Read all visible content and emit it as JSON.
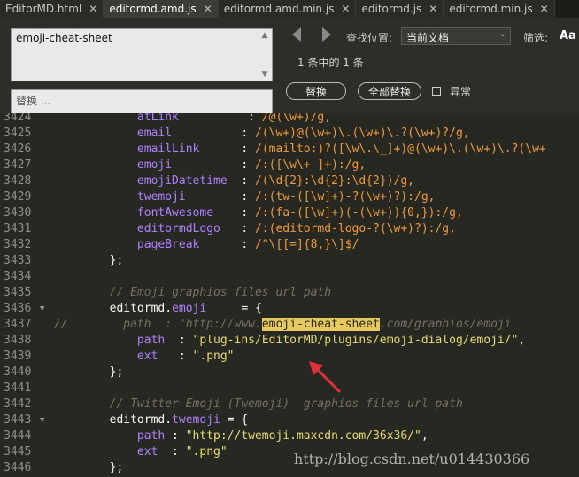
{
  "tabs": [
    {
      "label": "EditorMD.html",
      "active": false
    },
    {
      "label": "editormd.amd.js",
      "active": true
    },
    {
      "label": "editormd.amd.min.js",
      "active": false
    },
    {
      "label": "editormd.js",
      "active": false
    },
    {
      "label": "editormd.min.js",
      "active": false
    }
  ],
  "find": {
    "query": "emoji-cheat-sheet",
    "replace_placeholder": "替换 ...",
    "search_location_label": "查找位置:",
    "scope": "当前文档",
    "filter_label": "筛选:",
    "case_label": "Aa",
    "match_count": "1 条中的 1 条",
    "replace_button": "替换",
    "replace_all_button": "全部替换",
    "regex_label": "异常"
  },
  "editor": {
    "lines": [
      {
        "n": "3424",
        "fold": "",
        "parts": [
          {
            "t": "            ",
            "c": ""
          },
          {
            "t": "atLink",
            "c": "tok-prop"
          },
          {
            "t": "          : ",
            "c": ""
          },
          {
            "t": "/@(\\w+)/g,",
            "c": "tok-regex"
          }
        ]
      },
      {
        "n": "3425",
        "fold": "",
        "parts": [
          {
            "t": "            ",
            "c": ""
          },
          {
            "t": "email",
            "c": "tok-prop"
          },
          {
            "t": "          : ",
            "c": ""
          },
          {
            "t": "/(\\w+)@(\\w+)\\.(\\w+)\\.?(\\w+)?/g,",
            "c": "tok-regex"
          }
        ]
      },
      {
        "n": "3426",
        "fold": "",
        "parts": [
          {
            "t": "            ",
            "c": ""
          },
          {
            "t": "emailLink",
            "c": "tok-prop"
          },
          {
            "t": "      : ",
            "c": ""
          },
          {
            "t": "/(mailto:)?([\\w\\.\\_]+)@(\\w+)\\.(\\w+)\\.?(\\w+",
            "c": "tok-regex"
          }
        ]
      },
      {
        "n": "3427",
        "fold": "",
        "parts": [
          {
            "t": "            ",
            "c": ""
          },
          {
            "t": "emoji",
            "c": "tok-prop"
          },
          {
            "t": "          : ",
            "c": ""
          },
          {
            "t": "/:([\\w\\+-]+):/g,",
            "c": "tok-regex"
          }
        ]
      },
      {
        "n": "3428",
        "fold": "",
        "parts": [
          {
            "t": "            ",
            "c": ""
          },
          {
            "t": "emojiDatetime",
            "c": "tok-prop"
          },
          {
            "t": "  : ",
            "c": ""
          },
          {
            "t": "/(\\d{2}:\\d{2}:\\d{2})/g,",
            "c": "tok-regex"
          }
        ]
      },
      {
        "n": "3429",
        "fold": "",
        "parts": [
          {
            "t": "            ",
            "c": ""
          },
          {
            "t": "twemoji",
            "c": "tok-prop"
          },
          {
            "t": "        : ",
            "c": ""
          },
          {
            "t": "/:(tw-([\\w]+)-?(\\w+)?):/g,",
            "c": "tok-regex"
          }
        ]
      },
      {
        "n": "3430",
        "fold": "",
        "parts": [
          {
            "t": "            ",
            "c": ""
          },
          {
            "t": "fontAwesome",
            "c": "tok-prop"
          },
          {
            "t": "    : ",
            "c": ""
          },
          {
            "t": "/:(fa-([\\w]+)(-(\\w+)){0,}):/g,",
            "c": "tok-regex"
          }
        ]
      },
      {
        "n": "3431",
        "fold": "",
        "parts": [
          {
            "t": "            ",
            "c": ""
          },
          {
            "t": "editormdLogo",
            "c": "tok-prop"
          },
          {
            "t": "   : ",
            "c": ""
          },
          {
            "t": "/:(editormd-logo-?(\\w+)?):/g,",
            "c": "tok-regex"
          }
        ]
      },
      {
        "n": "3432",
        "fold": "",
        "parts": [
          {
            "t": "            ",
            "c": ""
          },
          {
            "t": "pageBreak",
            "c": "tok-prop"
          },
          {
            "t": "      : ",
            "c": ""
          },
          {
            "t": "/^\\[[=]{8,}\\]$/",
            "c": "tok-regex"
          }
        ]
      },
      {
        "n": "3433",
        "fold": "",
        "parts": [
          {
            "t": "        };",
            "c": ""
          }
        ]
      },
      {
        "n": "3434",
        "fold": "",
        "parts": [
          {
            "t": "",
            "c": ""
          }
        ]
      },
      {
        "n": "3435",
        "fold": "",
        "parts": [
          {
            "t": "        ",
            "c": ""
          },
          {
            "t": "// Emoji graphios files url path",
            "c": "tok-comment"
          }
        ]
      },
      {
        "n": "3436",
        "fold": "▼",
        "parts": [
          {
            "t": "        editormd.",
            "c": ""
          },
          {
            "t": "emoji",
            "c": "tok-prop"
          },
          {
            "t": "     = {",
            "c": ""
          }
        ]
      },
      {
        "n": "3437",
        "fold": "",
        "parts": [
          {
            "t": "//        path  : \"http://www.",
            "c": "tok-comment"
          },
          {
            "t": "emoji-cheat-sheet",
            "c": "tok-hl"
          },
          {
            "t": ".com/graphios/emoji",
            "c": "tok-comment"
          }
        ]
      },
      {
        "n": "3438",
        "fold": "",
        "parts": [
          {
            "t": "            ",
            "c": ""
          },
          {
            "t": "path",
            "c": "tok-prop"
          },
          {
            "t": "  : ",
            "c": ""
          },
          {
            "t": "\"plug-ins/EditorMD/plugins/emoji-dialog/emoji/\"",
            "c": "tok-str"
          },
          {
            "t": ",",
            "c": ""
          }
        ]
      },
      {
        "n": "3439",
        "fold": "",
        "parts": [
          {
            "t": "            ",
            "c": ""
          },
          {
            "t": "ext",
            "c": "tok-prop"
          },
          {
            "t": "   : ",
            "c": ""
          },
          {
            "t": "\".png\"",
            "c": "tok-str"
          }
        ]
      },
      {
        "n": "3440",
        "fold": "",
        "parts": [
          {
            "t": "        };",
            "c": ""
          }
        ]
      },
      {
        "n": "3441",
        "fold": "",
        "parts": [
          {
            "t": "",
            "c": ""
          }
        ]
      },
      {
        "n": "3442",
        "fold": "",
        "parts": [
          {
            "t": "        ",
            "c": ""
          },
          {
            "t": "// Twitter Emoji (Twemoji)  graphios files url path",
            "c": "tok-comment"
          }
        ]
      },
      {
        "n": "3443",
        "fold": "▼",
        "parts": [
          {
            "t": "        editormd.",
            "c": ""
          },
          {
            "t": "twemoji",
            "c": "tok-prop"
          },
          {
            "t": " = {",
            "c": ""
          }
        ]
      },
      {
        "n": "3444",
        "fold": "",
        "parts": [
          {
            "t": "            ",
            "c": ""
          },
          {
            "t": "path",
            "c": "tok-prop"
          },
          {
            "t": " : ",
            "c": ""
          },
          {
            "t": "\"http://twemoji.maxcdn.com/36x36/\"",
            "c": "tok-str"
          },
          {
            "t": ",",
            "c": ""
          }
        ]
      },
      {
        "n": "3445",
        "fold": "",
        "parts": [
          {
            "t": "            ",
            "c": ""
          },
          {
            "t": "ext",
            "c": "tok-prop"
          },
          {
            "t": "  : ",
            "c": ""
          },
          {
            "t": "\".png\"",
            "c": "tok-str"
          }
        ]
      },
      {
        "n": "3446",
        "fold": "",
        "parts": [
          {
            "t": "        };",
            "c": ""
          }
        ]
      }
    ]
  },
  "watermark": "http://blog.csdn.net/u014430366",
  "colors": {
    "background": "#272822",
    "property": "#ae81ff",
    "regex": "#f09b3b",
    "string": "#e6db74",
    "comment": "#75715e",
    "highlight": "#e6c95f",
    "arrow": "#e0303a"
  }
}
